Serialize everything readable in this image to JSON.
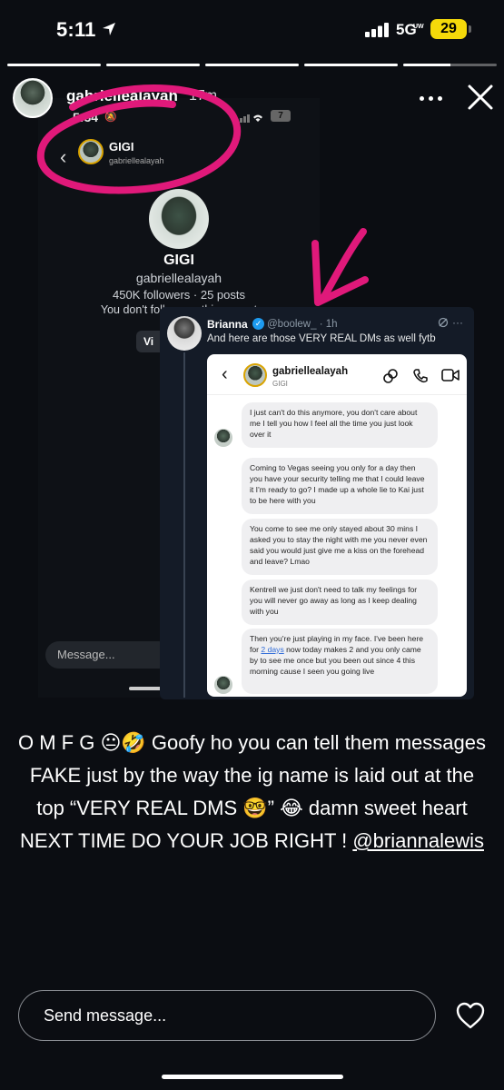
{
  "status_bar": {
    "time": "5:11",
    "network": "5G",
    "network_sub": "UW",
    "battery": "29",
    "battery_color": "#f5d90a"
  },
  "story": {
    "progress_segments": [
      1,
      1,
      1,
      1,
      0.5
    ],
    "username": "gabriellealayah",
    "time_ago": "17m",
    "more_icon": "more-horizontal-icon",
    "close_icon": "close-icon"
  },
  "background_screenshot": {
    "status_time": "5:34",
    "battery": "7",
    "header_title": "GIGI",
    "header_sub": "gabriellealayah",
    "profile_name": "GIGI",
    "profile_handle": "gabriellealayah",
    "stats": "450K followers · 25 posts",
    "follow_note": "You don't follow e... this ... ount",
    "view_button": "Vi",
    "message_placeholder": "Message..."
  },
  "annotation_color": "#e0197a",
  "tweet": {
    "name": "Brianna",
    "handle": "@boolew_ · 1h",
    "text": "And here are those VERY REAL DMs as well fytb",
    "dm": {
      "username": "gabriellealayah",
      "subtitle": "GIGI",
      "messages": [
        "I just can't do this anymore, you don't care about me I tell you how I feel all the time you just look over it",
        "Coming to Vegas seeing you only for a day then you have your security telling me that I could leave it I'm ready to go? I made up a whole lie to Kai just to be here with you",
        "You come to see me only stayed about 30 mins I asked you to stay the night with me you never even said you would just give me a kiss on the forehead and leave? Lmao",
        "Kentrell we just don't need to talk my feelings for you will never go away as long as I keep dealing with you",
        "Then you're just playing in my face. I've been here for ",
        "2 days",
        " now today makes 2 and you only came by to see me once but you been out since 4 this morning cause I seen you going live"
      ]
    }
  },
  "caption": {
    "text": "O M F G 😐🤣  Goofy ho you can tell them messages FAKE  just by the way the ig name is laid out at the top “VERY REAL DMS 🤓” 😂 damn sweet heart  NEXT TIME DO YOUR JOB RIGHT ! ",
    "mention": "@briannalewis"
  },
  "composer": {
    "placeholder": "Send message...",
    "heart_icon": "heart-icon"
  }
}
